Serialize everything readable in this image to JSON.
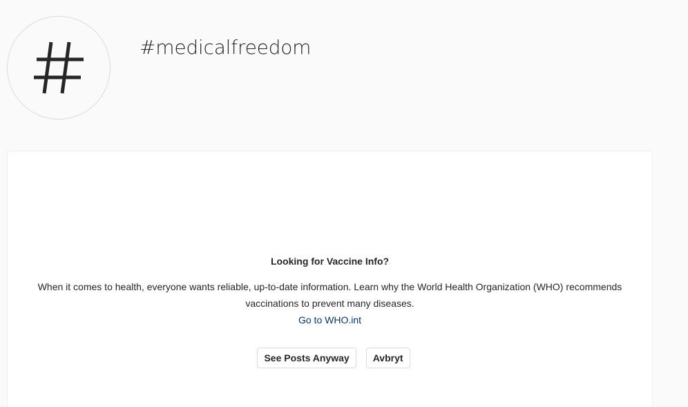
{
  "header": {
    "avatar_icon": "hashtag-icon",
    "hashtag": "#medicalfreedom"
  },
  "warning": {
    "title": "Looking for Vaccine Info?",
    "body": "When it comes to health, everyone wants reliable, up-to-date information. Learn why the World Health Organization (WHO) recommends vaccinations to prevent many diseases.",
    "link_label": "Go to WHO.int",
    "see_posts_label": "See Posts Anyway",
    "cancel_label": "Avbryt"
  },
  "colors": {
    "page_background": "#fafafa",
    "card_background": "#ffffff",
    "link": "#00376b",
    "text": "#262626",
    "border": "#dbdbdb"
  }
}
